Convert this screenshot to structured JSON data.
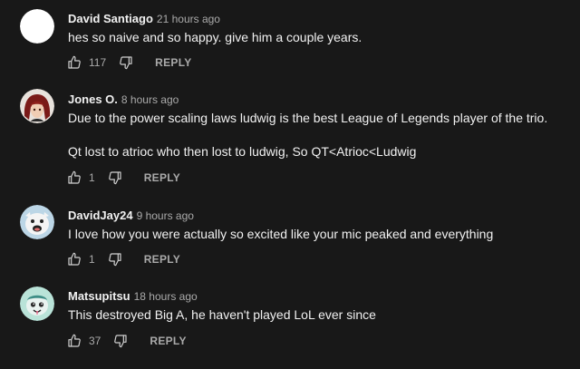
{
  "comments": [
    {
      "author": "David Santiago",
      "time": "21 hours ago",
      "lines": [
        "hes so naive and so happy. give him a couple years."
      ],
      "likes": "117",
      "reply_label": "REPLY"
    },
    {
      "author": "Jones O.",
      "time": "8 hours ago",
      "lines": [
        "Due to the power scaling laws ludwig is the best League of Legends player of the trio.",
        "Qt lost to atrioc who then lost to ludwig, So QT<Atrioc<Ludwig"
      ],
      "likes": "1",
      "reply_label": "REPLY"
    },
    {
      "author": "DavidJay24",
      "time": "9 hours ago",
      "lines": [
        "I love how you were actually so excited like your mic peaked and everything"
      ],
      "likes": "1",
      "reply_label": "REPLY"
    },
    {
      "author": "Matsupitsu",
      "time": "18 hours ago",
      "lines": [
        "This destroyed Big A, he haven't played LoL ever since"
      ],
      "likes": "37",
      "reply_label": "REPLY"
    }
  ],
  "colors": {
    "background": "#181818",
    "text": "#f1f1f1",
    "secondary": "#aaaaaa"
  },
  "icons": {
    "like": "thumbs-up-icon",
    "dislike": "thumbs-down-icon"
  }
}
